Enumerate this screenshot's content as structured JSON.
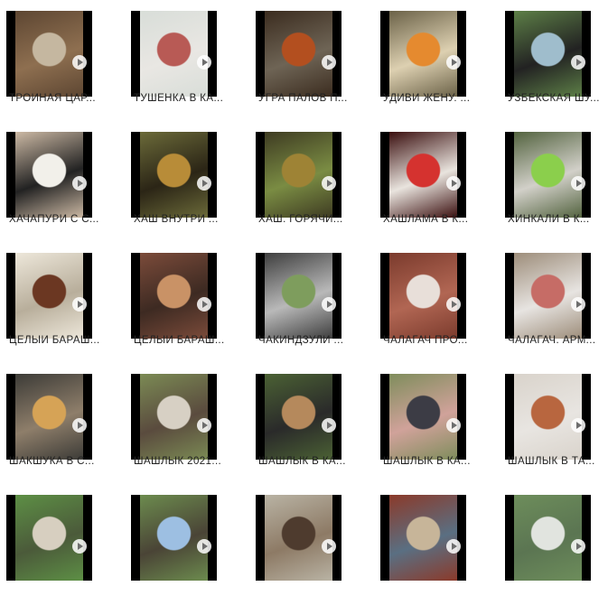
{
  "items": [
    {
      "label": "ТРОЙНАЯ ЦАР...",
      "colors": [
        "#5d4632",
        "#c5b7a0",
        "#8e6f50"
      ]
    },
    {
      "label": "ТУШЕНКА В КА...",
      "colors": [
        "#d8ddd8",
        "#b85a55",
        "#e9e7e3"
      ]
    },
    {
      "label": "УГРА ПАЛОВ П...",
      "colors": [
        "#3b2c1f",
        "#b34f1f",
        "#6e6455"
      ]
    },
    {
      "label": "УДИВИ ЖЕНУ. ...",
      "colors": [
        "#6b6248",
        "#e58a2f",
        "#ddd0b1"
      ]
    },
    {
      "label": "УЗБЕКСКАЯ ШУ...",
      "colors": [
        "#5d7f47",
        "#9fbdcc",
        "#222222"
      ]
    },
    {
      "label": "ХАЧАПУРИ С С...",
      "colors": [
        "#ccb9a4",
        "#f2f0ea",
        "#222222"
      ]
    },
    {
      "label": "ХАШ ВНУТРИ ...",
      "colors": [
        "#6b6a39",
        "#b88c38",
        "#2b2516"
      ]
    },
    {
      "label": "ХАШ. ГОРЯЧИ...",
      "colors": [
        "#3e3b22",
        "#9e8335",
        "#7a8c43"
      ]
    },
    {
      "label": "ХАШЛАМА В К...",
      "colors": [
        "#3b0f0f",
        "#d5322f",
        "#e9e4de"
      ]
    },
    {
      "label": "ХИНКАЛИ В К...",
      "colors": [
        "#53633f",
        "#8bcf4c",
        "#d2d0c9"
      ]
    },
    {
      "label": "ЦЕЛЫЙ БАРАШ...",
      "colors": [
        "#ede7da",
        "#6b3722",
        "#b8ae9b"
      ]
    },
    {
      "label": "ЦЕЛЫЙ БАРАШ...",
      "colors": [
        "#7b4b3a",
        "#c99266",
        "#3d2a22"
      ]
    },
    {
      "label": "ЧАКИНДЗУЛИ ...",
      "colors": [
        "#3e3e3e",
        "#7e9d5d",
        "#b9b9b9"
      ]
    },
    {
      "label": "ЧАЛАГАЧ  ПРО...",
      "colors": [
        "#7b3b2d",
        "#e8dfd9",
        "#b16653"
      ]
    },
    {
      "label": "ЧАЛАГАЧ. АРМ...",
      "colors": [
        "#9d8d7a",
        "#c66c66",
        "#e7e4e1"
      ]
    },
    {
      "label": "ШАКШУКА В С...",
      "colors": [
        "#3c3b37",
        "#d6a356",
        "#8e7e6a"
      ]
    },
    {
      "label": "ШАШЛЫК 2021...",
      "colors": [
        "#7b8a54",
        "#d7d0c4",
        "#5a4b3e"
      ]
    },
    {
      "label": "ШАШЛЫК В КА...",
      "colors": [
        "#4b6134",
        "#b5895c",
        "#2a2a2a"
      ]
    },
    {
      "label": "ШАШЛЫК В КА...",
      "colors": [
        "#7f8d5c",
        "#3c3c45",
        "#d0a29a"
      ]
    },
    {
      "label": "ШАШЛЫК В ТА...",
      "colors": [
        "#d9d3cb",
        "#b8663f",
        "#e8e5e1"
      ]
    },
    {
      "label": "",
      "colors": [
        "#5d8f45",
        "#d7cfc0",
        "#4b5a3a"
      ]
    },
    {
      "label": "",
      "colors": [
        "#6c8b4e",
        "#9dbfe2",
        "#4a4436"
      ]
    },
    {
      "label": "",
      "colors": [
        "#b9b3a4",
        "#4e3b2e",
        "#8d7a65"
      ]
    },
    {
      "label": "",
      "colors": [
        "#8b3a2a",
        "#c7b599",
        "#5a6f82"
      ]
    },
    {
      "label": "",
      "colors": [
        "#6d8d5b",
        "#e1e4df",
        "#5b7552"
      ]
    }
  ],
  "icons": {
    "play": "play-icon"
  }
}
